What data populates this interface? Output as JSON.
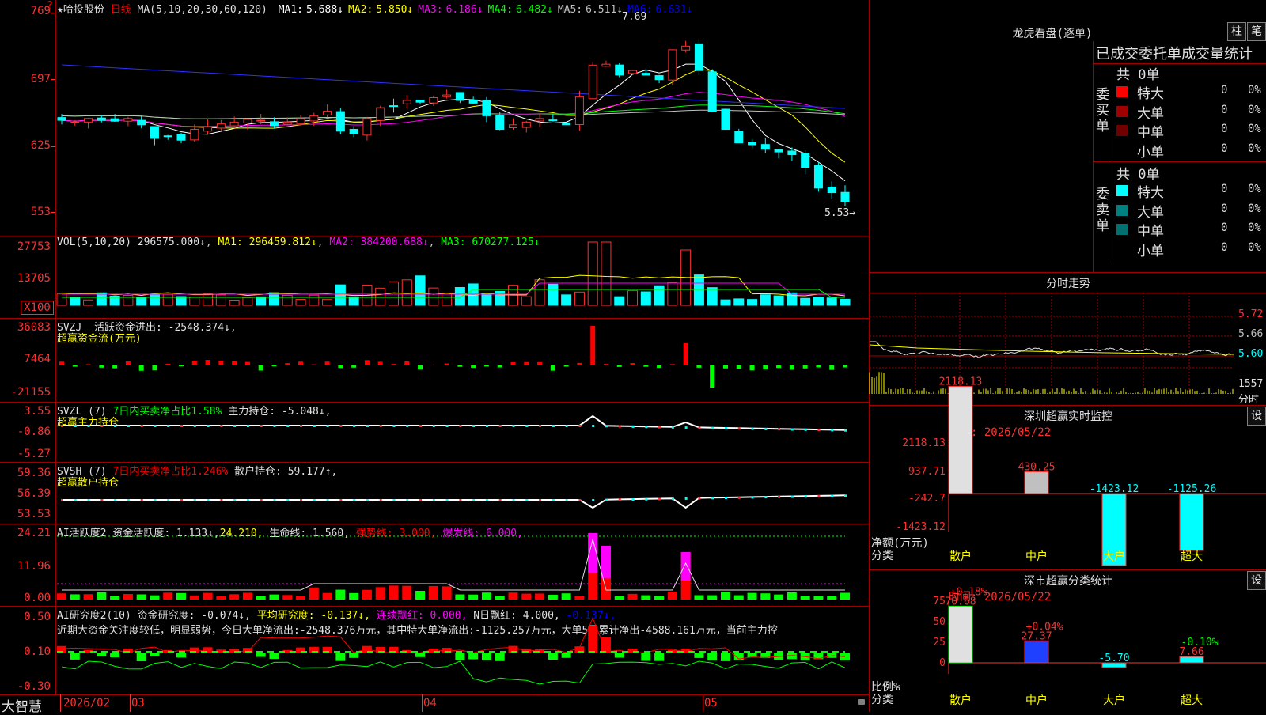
{
  "stock": {
    "name": "★哈投股份",
    "period": "日线",
    "ma_cfg": "MA(5,10,20,30,60,120)",
    "ma": [
      {
        "label": "MA1:",
        "value": "5.688↓",
        "color": "#ffffff"
      },
      {
        "label": "MA2:",
        "value": "5.850↓",
        "color": "#ffff00"
      },
      {
        "label": "MA3:",
        "value": "6.186↓",
        "color": "#ff00ff"
      },
      {
        "label": "MA4:",
        "value": "6.482↓",
        "color": "#00ff00"
      },
      {
        "label": "MA5:",
        "value": "6.511↓",
        "color": "#c0c0c0"
      },
      {
        "label": "MA6:",
        "value": "6.631↓",
        "color": "#0000ff"
      }
    ],
    "high_label": "7.69",
    "low_label": "5.53→",
    "question": "?"
  },
  "price_axis": [
    "769",
    "697",
    "625",
    "553"
  ],
  "vol": {
    "cfg": "VOL(5,10,20)",
    "value": "296575.000↓",
    "ma1": "MA1: 296459.812↓",
    "ma2": "MA2: 384200.688↓",
    "ma3": "MA3: 670277.125↓",
    "axis": [
      "27753",
      "13705"
    ],
    "unit": "X100"
  },
  "svzj": {
    "name": "SVZJ",
    "label": "活跃资金进出: -2548.374↓,",
    "sub": "超赢资金流(万元)",
    "axis": [
      "36083",
      "7464",
      "-21155"
    ]
  },
  "svzl": {
    "name": "SVZL (7)",
    "label1": "7日内买卖净占比1.58%",
    "label2": "主力持仓: -5.048↓,",
    "sub": "超赢主力持仓",
    "axis": [
      "3.55",
      "-0.86",
      "-5.27"
    ]
  },
  "svsh": {
    "name": "SVSH (7)",
    "label1": "7日内买卖净占比1.246%",
    "label2": "散户持仓: 59.177↑,",
    "sub": "超赢散户持仓",
    "axis": [
      "59.36",
      "56.39",
      "53.53"
    ]
  },
  "aihyd": {
    "name": "AI活跃度2",
    "l1": "资金活跃度: 1.133↓,",
    "l2": "24.210,",
    "l3": "生命线: 1.560,",
    "l4": "强势线: 3.000,",
    "l5": "爆发线: 6.000,",
    "axis": [
      "24.21",
      "11.96",
      "0.00"
    ]
  },
  "aiyjd": {
    "name": "AI研究度2(10)",
    "l1": "资金研究度: -0.074↓,",
    "l2": "平均研究度: -0.137↓,",
    "l3": "连续飘红: 0.000,",
    "l4": "N日飘红: 4.000,",
    "l5": "-0.137↓,",
    "text": "近期大资金关注度较低，明显弱势，今日大单净流出:-2548.376万元，其中特大单净流出:-1125.257万元，大单5日累计净出-4588.161万元，当前主力控",
    "axis": [
      "0.50",
      "0.10",
      "-0.30"
    ]
  },
  "xaxis": {
    "brand": "大智慧",
    "labels": [
      "2026/02",
      "03",
      "04",
      "05"
    ]
  },
  "lhb": {
    "title": "龙虎看盘(逐单)",
    "btn1": "柱",
    "btn2": "笔",
    "heading": "已成交委托单成交量统计",
    "buy_side": "委买单",
    "sell_side": "委卖单",
    "total": "共 0单",
    "buy_rows": [
      {
        "name": "特大",
        "color": "#ff0000",
        "v": "0",
        "p": "0%"
      },
      {
        "name": "大单",
        "color": "#a00000",
        "v": "0",
        "p": "0%"
      },
      {
        "name": "中单",
        "color": "#700000",
        "v": "0",
        "p": "0%"
      },
      {
        "name": "小单",
        "color": "#000000",
        "v": "0",
        "p": "0%"
      }
    ],
    "sell_rows": [
      {
        "name": "特大",
        "color": "#00ffff",
        "v": "0",
        "p": "0%"
      },
      {
        "name": "大单",
        "color": "#008080",
        "v": "0",
        "p": "0%"
      },
      {
        "name": "中单",
        "color": "#007070",
        "v": "0",
        "p": "0%"
      },
      {
        "name": "小单",
        "color": "#000000",
        "v": "0",
        "p": "0%"
      }
    ]
  },
  "fenshi": {
    "title": "分时走势",
    "axis": [
      "5.72",
      "5.66",
      "5.60",
      "1557",
      "分时"
    ]
  },
  "sz_monitor": {
    "title": "深圳超赢实时监控",
    "btn": "设",
    "time": "时间: 2026/05/22",
    "ylab": "净额(万元)",
    "cls": "分类",
    "axis": [
      "2118.13",
      "937.71",
      "-242.7",
      "-1423.12"
    ],
    "bars": [
      {
        "cat": "散户",
        "val": 2118.13,
        "label": "2118.13"
      },
      {
        "cat": "中户",
        "val": 430.25,
        "label": "430.25"
      },
      {
        "cat": "大户",
        "val": -1423.12,
        "label": "-1423.12"
      },
      {
        "cat": "超大",
        "val": -1125.26,
        "label": "-1125.26"
      }
    ]
  },
  "sz_stats": {
    "title": "深市超赢分类统计",
    "btn": "设",
    "time": "时间: 2026/05/22",
    "ylab": "比例%",
    "cls": "分类",
    "axis": [
      "75",
      "50",
      "25",
      "0"
    ],
    "bars": [
      {
        "cat": "散户",
        "val": 70.68,
        "label": "70.68",
        "delta": "+0.18%"
      },
      {
        "cat": "中户",
        "val": 27.37,
        "label": "27.37",
        "delta": "+0.04%"
      },
      {
        "cat": "大户",
        "val": -5.7,
        "label": "-5.70",
        "delta": ""
      },
      {
        "cat": "超大",
        "val": 7.66,
        "label": "7.66",
        "delta": "-0.10%"
      }
    ]
  }
}
